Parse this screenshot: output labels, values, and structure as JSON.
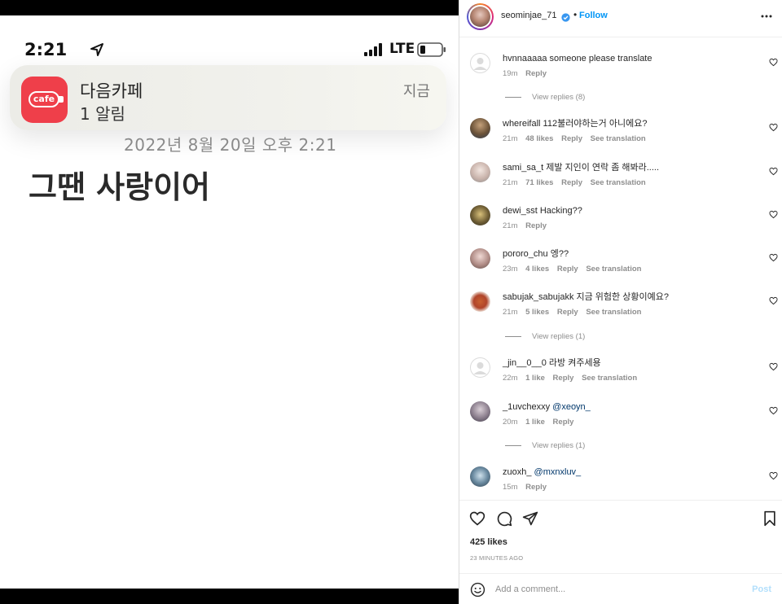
{
  "media": {
    "status_time": "2:21",
    "network": "LTE",
    "notification": {
      "icon_text": "cafe",
      "app_name": "다음카페",
      "subtitle": "1 알림",
      "when": "지금"
    },
    "dateline": "2022년 8월 20일 오후 2:21",
    "message": "그땐 사랑이어"
  },
  "post": {
    "username": "seominjae_71",
    "separator": "•",
    "follow_label": "Follow",
    "likes": "425 likes",
    "time_ago": "23 MINUTES AGO",
    "add_comment_placeholder": "Add a comment...",
    "post_label": "Post"
  },
  "comments": [
    {
      "user": "hvnnaaaaa",
      "text": "someone please translate",
      "time": "19m",
      "likes": "",
      "reply": "Reply",
      "see_translation": ""
    },
    {
      "user": "whereifall",
      "text": "112불러야하는거 아니에요?",
      "time": "21m",
      "likes": "48 likes",
      "reply": "Reply",
      "see_translation": "See translation"
    },
    {
      "user": "sami_sa_t",
      "text": "제발 지인이 연락 좀 해봐라.....",
      "time": "21m",
      "likes": "71 likes",
      "reply": "Reply",
      "see_translation": "See translation"
    },
    {
      "user": "dewi_sst",
      "text": "Hacking??",
      "time": "21m",
      "likes": "",
      "reply": "Reply",
      "see_translation": ""
    },
    {
      "user": "pororo_chu",
      "text": "엥??",
      "time": "23m",
      "likes": "4 likes",
      "reply": "Reply",
      "see_translation": "See translation"
    },
    {
      "user": "sabujak_sabujakk",
      "text": "지금 위험한 상황이예요?",
      "time": "21m",
      "likes": "5 likes",
      "reply": "Reply",
      "see_translation": "See translation"
    },
    {
      "user": "_jin__0__0",
      "text": "라방 켜주세용",
      "time": "22m",
      "likes": "1 like",
      "reply": "Reply",
      "see_translation": "See translation"
    },
    {
      "user": "_1uvchexxy",
      "text": "",
      "mention": "@xeoyn_",
      "time": "20m",
      "likes": "1 like",
      "reply": "Reply",
      "see_translation": ""
    },
    {
      "user": "zuoxh_",
      "text": "",
      "mention": "@mxnxluv_",
      "time": "15m",
      "likes": "",
      "reply": "Reply",
      "see_translation": ""
    }
  ],
  "view_replies": [
    "View replies (8)",
    "View replies (1)",
    "View replies (1)"
  ],
  "colors": {
    "accent_blue": "#0095f6",
    "app_red": "#ef3f4a",
    "muted_gray": "#8e8e8e"
  },
  "icons": [
    "location-arrow-icon",
    "signal-bars-icon",
    "battery-icon",
    "verified-icon",
    "more-icon",
    "heart-icon",
    "comment-icon",
    "share-icon",
    "bookmark-icon",
    "emoji-icon"
  ]
}
